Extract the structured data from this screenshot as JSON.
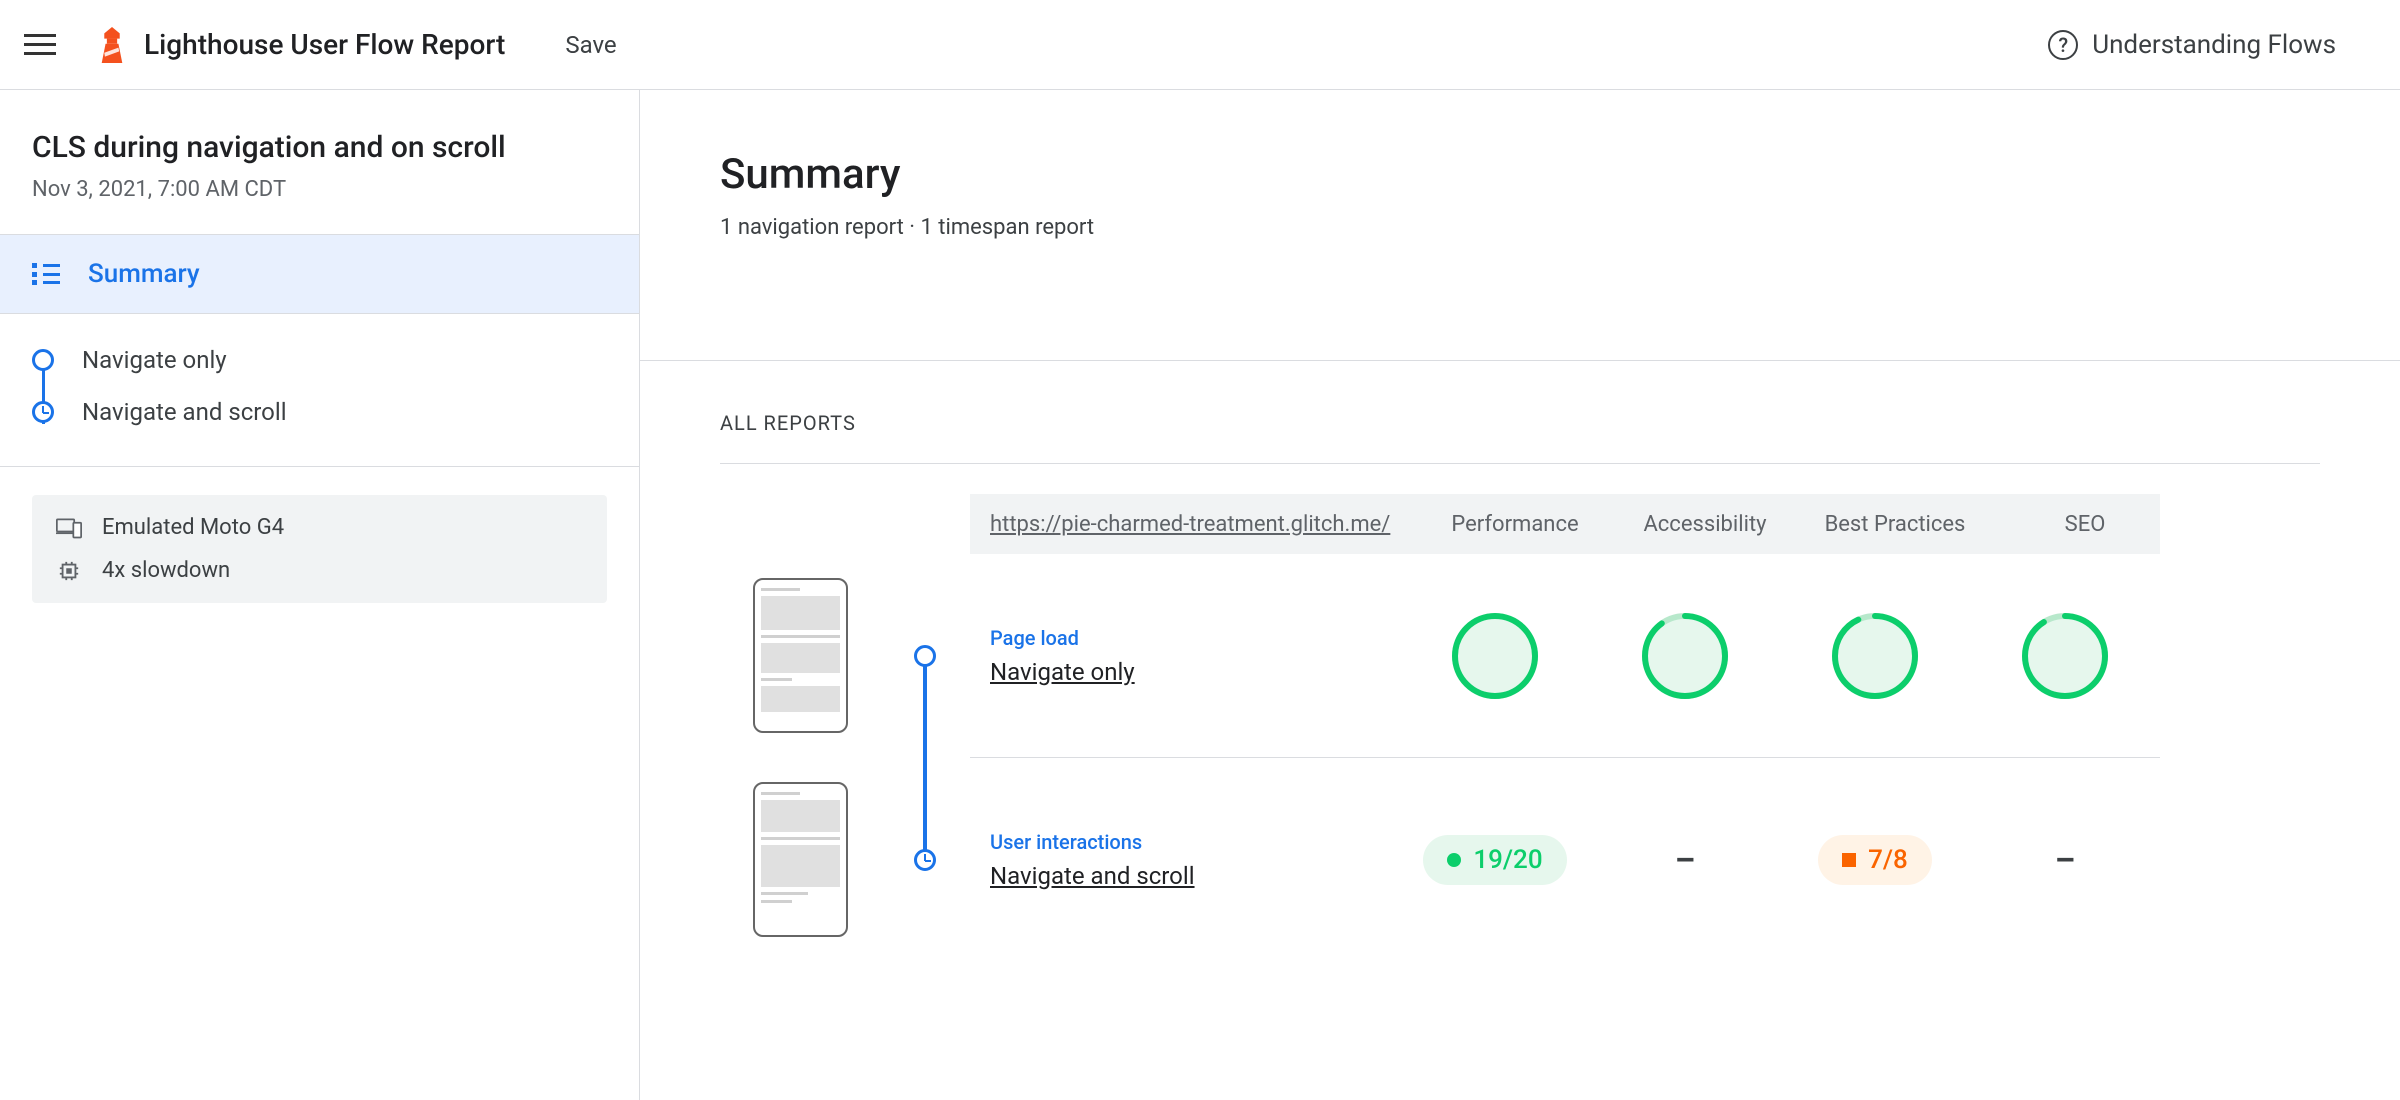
{
  "topbar": {
    "title": "Lighthouse User Flow Report",
    "save": "Save",
    "help": "Understanding Flows"
  },
  "sidebar": {
    "flow_title": "CLS during navigation and on scroll",
    "date": "Nov 3, 2021, 7:00 AM CDT",
    "summary_label": "Summary",
    "steps": [
      {
        "label": "Navigate only",
        "type": "navigation"
      },
      {
        "label": "Navigate and scroll",
        "type": "timespan"
      }
    ],
    "settings": {
      "device": "Emulated Moto G4",
      "cpu": "4x slowdown"
    }
  },
  "main": {
    "title": "Summary",
    "subtitle": "1 navigation report · 1 timespan report",
    "all_reports_label": "ALL REPORTS",
    "table": {
      "url": "https://pie-charmed-treatment.glitch.me/",
      "columns": [
        "Performance",
        "Accessibility",
        "Best Practices",
        "SEO"
      ],
      "rows": [
        {
          "type_label": "Page load",
          "name": "Navigate only",
          "icon": "navigation",
          "scores": [
            {
              "kind": "gauge",
              "value": 100,
              "rating": "pass"
            },
            {
              "kind": "gauge",
              "value": 90,
              "rating": "pass"
            },
            {
              "kind": "gauge",
              "value": 93,
              "rating": "pass"
            },
            {
              "kind": "gauge",
              "value": 91,
              "rating": "pass"
            }
          ]
        },
        {
          "type_label": "User interactions",
          "name": "Navigate and scroll",
          "icon": "timespan",
          "scores": [
            {
              "kind": "fraction",
              "value": "19/20",
              "rating": "pass"
            },
            {
              "kind": "dash"
            },
            {
              "kind": "fraction",
              "value": "7/8",
              "rating": "avg"
            },
            {
              "kind": "dash"
            }
          ]
        }
      ]
    }
  }
}
